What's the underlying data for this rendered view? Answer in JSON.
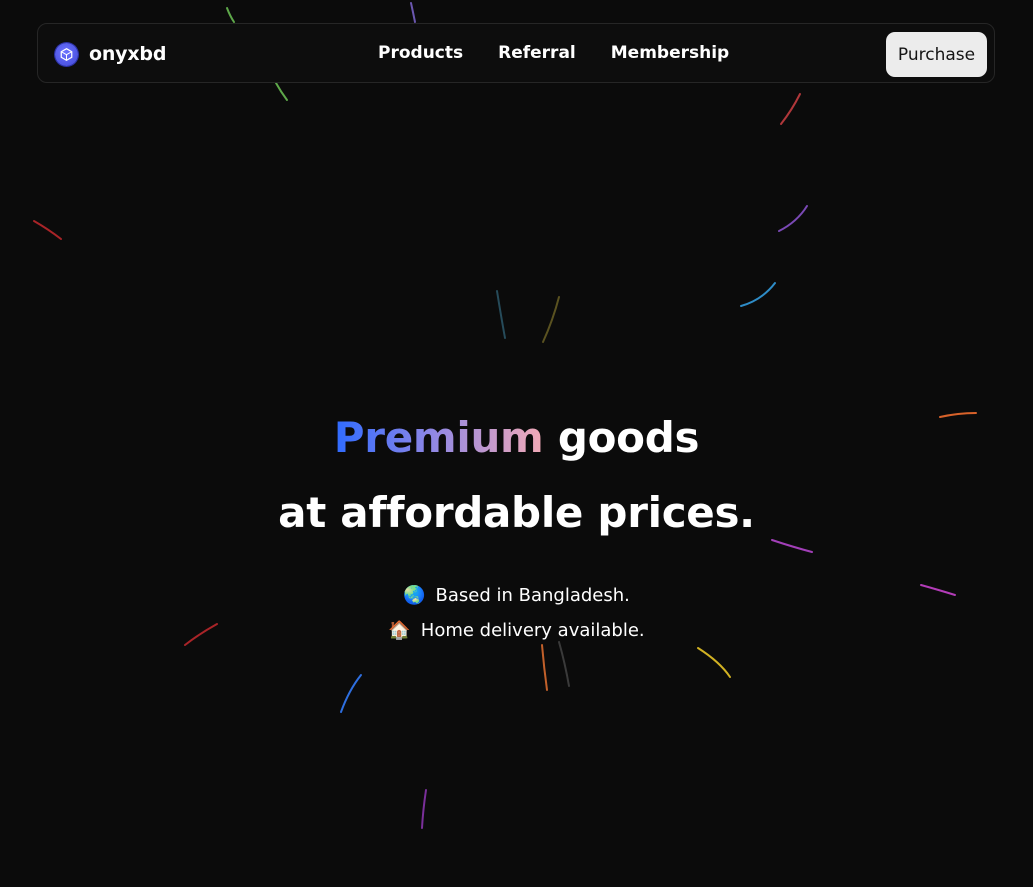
{
  "brand": {
    "name": "onyxbd",
    "icon": "cube-icon",
    "accent": "#4f55e8"
  },
  "nav": {
    "links": [
      {
        "label": "Products"
      },
      {
        "label": "Referral"
      },
      {
        "label": "Membership"
      }
    ],
    "purchase_label": "Purchase"
  },
  "hero": {
    "highlight": "Premium",
    "title_rest": " goods",
    "line2": "at affordable prices.",
    "gradient_colors": [
      "#2f6bff",
      "#8c86e6",
      "#f3aab6"
    ],
    "info": [
      {
        "icon": "globe-emoji",
        "emoji": "🌏",
        "text": "Based in Bangladesh."
      },
      {
        "icon": "house-emoji",
        "emoji": "🏠",
        "text": "Home delivery available."
      }
    ]
  },
  "background": {
    "color": "#0b0b0b",
    "decoration": "colored-streaks"
  }
}
